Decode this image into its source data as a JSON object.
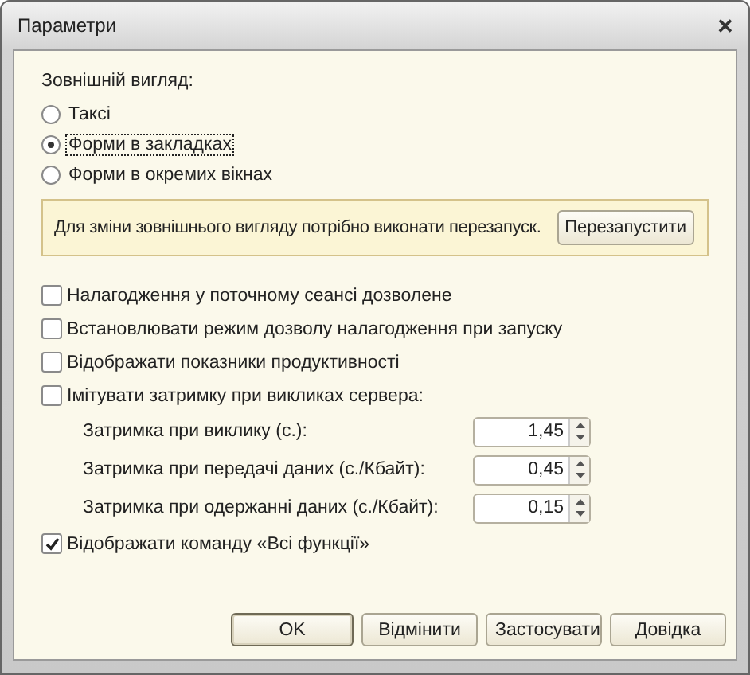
{
  "window": {
    "title": "Параметри",
    "close": "✕"
  },
  "appearance": {
    "label": "Зовнішній вигляд:",
    "options": [
      {
        "label": "Таксі",
        "selected": false,
        "focused": false
      },
      {
        "label": "Форми в закладках",
        "selected": true,
        "focused": true
      },
      {
        "label": "Форми в окремих вікнах",
        "selected": false,
        "focused": false
      }
    ]
  },
  "notice": {
    "text": "Для зміни зовнішнього вигляду потрібно виконати перезапуск.",
    "button": "Перезапустити"
  },
  "settings": [
    {
      "kind": "checkbox",
      "label": "Налагодження у поточному сеансі дозволене",
      "checked": false
    },
    {
      "kind": "checkbox",
      "label": "Встановлювати режим дозволу налагодження при запуску",
      "checked": false
    },
    {
      "kind": "checkbox",
      "label": "Відображати показники продуктивності",
      "checked": false
    },
    {
      "kind": "checkbox",
      "label": "Імітувати затримку при викликах сервера:",
      "checked": false
    },
    {
      "kind": "number",
      "label": "Затримка при виклику (с.):",
      "value": "1,45"
    },
    {
      "kind": "number",
      "label": "Затримка при передачі даних (с./Кбайт):",
      "value": "0,45"
    },
    {
      "kind": "number",
      "label": "Затримка при одержанні даних (с./Кбайт):",
      "value": "0,15"
    },
    {
      "kind": "checkbox",
      "label": "Відображати команду «Всі функції»",
      "checked": true
    }
  ],
  "buttons": [
    {
      "label": "OK",
      "default": true
    },
    {
      "label": "Відмінити",
      "default": false
    },
    {
      "label": "Застосувати",
      "default": false
    },
    {
      "label": "Довідка",
      "default": false
    }
  ]
}
